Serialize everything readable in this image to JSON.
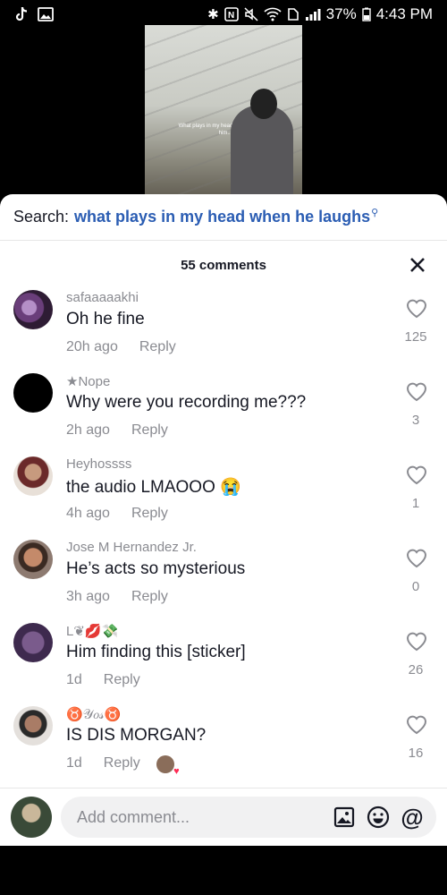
{
  "status_bar": {
    "battery": "37%",
    "time": "4:43 PM"
  },
  "video": {
    "caption": "What plays in my head every time I see him..."
  },
  "search": {
    "prefix": "Search:",
    "query": "what plays in my head when he laughs"
  },
  "comments_header": {
    "count_label": "55 comments"
  },
  "comments": [
    {
      "user": "safaaaaakhi",
      "text": "Oh he fine",
      "time": "20h ago",
      "reply": "Reply",
      "likes": "125"
    },
    {
      "user": "★Nope",
      "text": "Why were you recording me???",
      "time": "2h ago",
      "reply": "Reply",
      "likes": "3"
    },
    {
      "user": "Heyhossss",
      "text": "the audio LMAOOO 😭",
      "time": "4h ago",
      "reply": "Reply",
      "likes": "1"
    },
    {
      "user": "Jose M Hernandez Jr.",
      "text": "He’s acts so mysterious",
      "time": "3h ago",
      "reply": "Reply",
      "likes": "0"
    },
    {
      "user": "L❦💋💸",
      "text": "Him finding this [sticker]",
      "time": "1d",
      "reply": "Reply",
      "likes": "26"
    },
    {
      "user": "♉𝒴𝑜𝓈♉",
      "text": "IS DIS MORGAN?",
      "time": "1d",
      "reply": "Reply",
      "likes": "16"
    }
  ],
  "comment_input": {
    "placeholder": "Add comment..."
  },
  "colors": {
    "accent_blue": "#2b5db3",
    "like_pink": "#fe2c55"
  }
}
